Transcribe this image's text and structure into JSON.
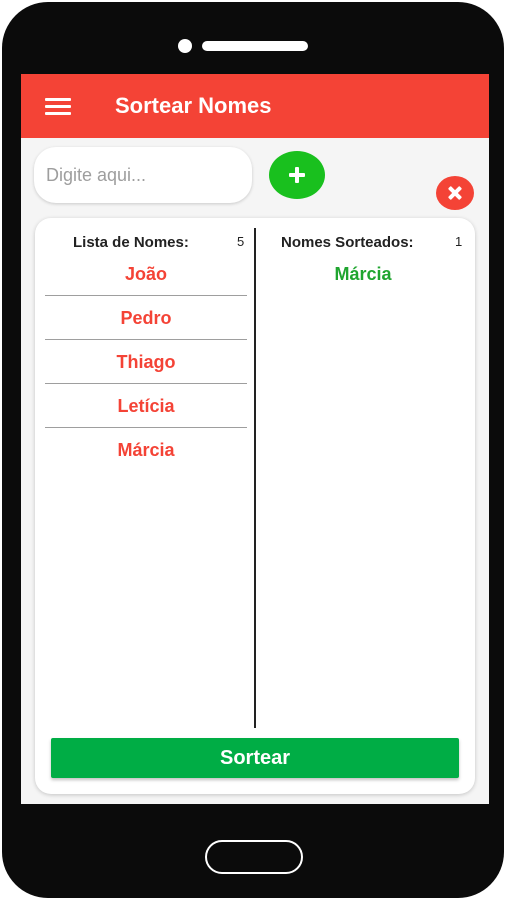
{
  "app_bar": {
    "title": "Sortear Nomes",
    "menu_icon": "hamburger-menu-icon"
  },
  "input": {
    "placeholder": "Digite aqui...",
    "value": ""
  },
  "add_button": {
    "icon": "plus-icon"
  },
  "clear_button": {
    "icon": "close-icon"
  },
  "names_column": {
    "header": "Lista de Nomes:",
    "count": "5",
    "items": [
      "João",
      "Pedro",
      "Thiago",
      "Letícia",
      "Márcia"
    ]
  },
  "drawn_column": {
    "header": "Nomes Sorteados:",
    "count": "1",
    "items": [
      "Márcia"
    ]
  },
  "draw_button": {
    "label": "Sortear"
  },
  "colors": {
    "app_bar": "#f44336",
    "add_button": "#19c01e",
    "clear_button": "#f44336",
    "name_text": "#f44336",
    "drawn_text": "#1fa52f",
    "draw_button": "#00ad45",
    "phone_body": "#0b0b0b"
  }
}
